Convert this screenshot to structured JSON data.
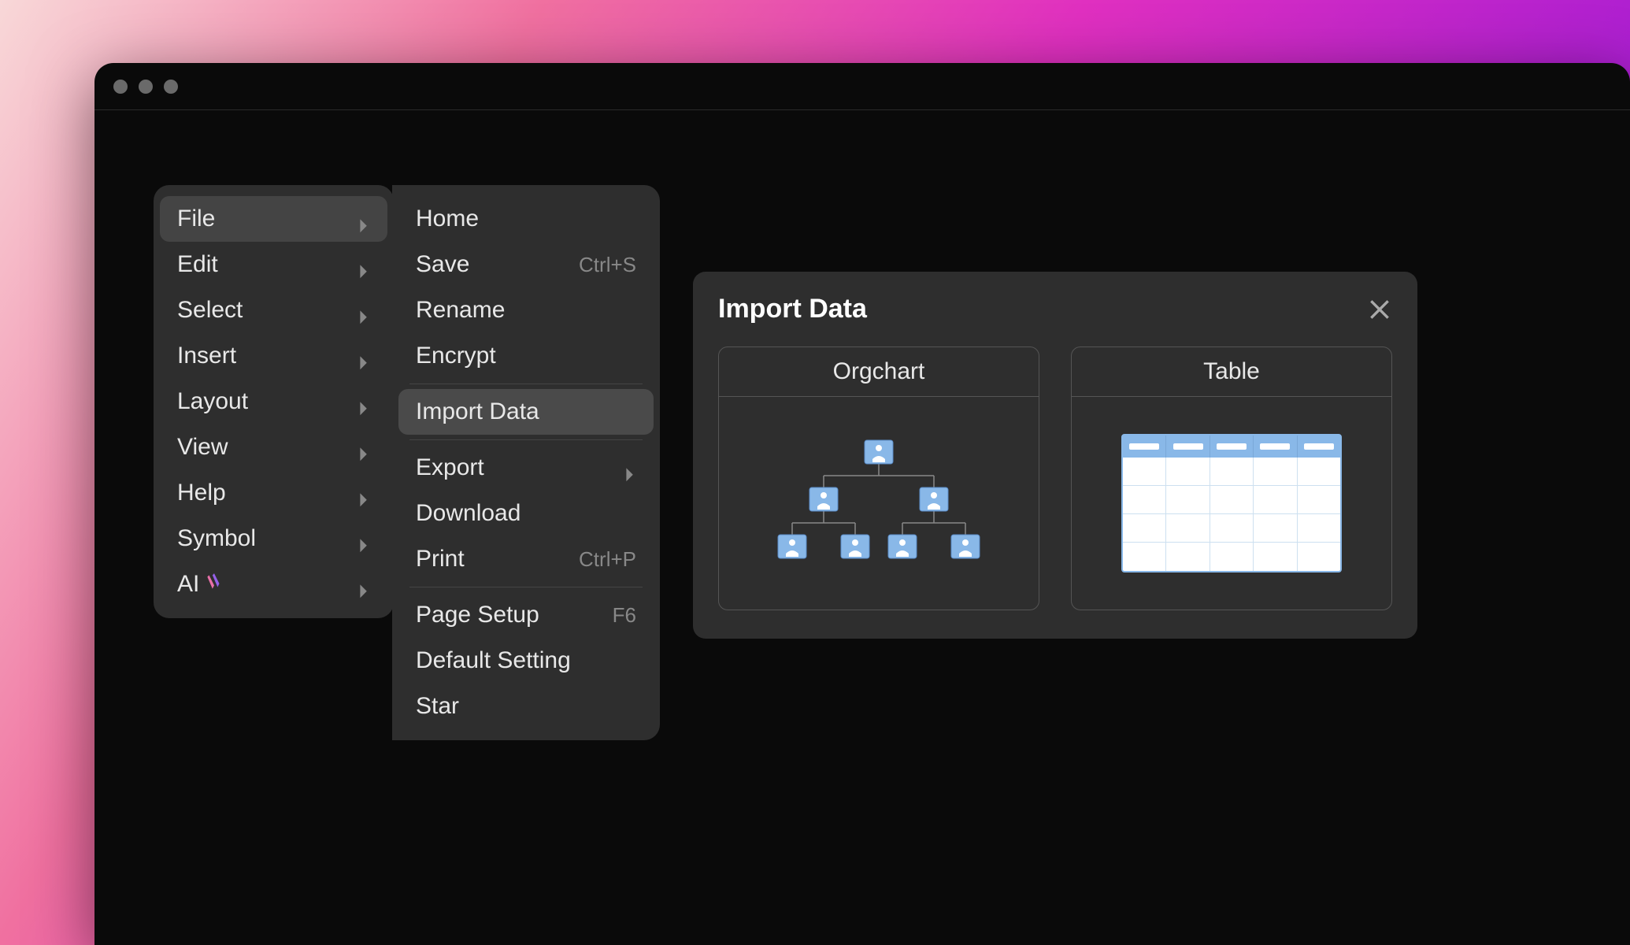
{
  "main_menu": {
    "items": [
      {
        "label": "File",
        "has_submenu": true,
        "active": true
      },
      {
        "label": "Edit",
        "has_submenu": true
      },
      {
        "label": "Select",
        "has_submenu": true
      },
      {
        "label": "Insert",
        "has_submenu": true
      },
      {
        "label": "Layout",
        "has_submenu": true
      },
      {
        "label": "View",
        "has_submenu": true
      },
      {
        "label": "Help",
        "has_submenu": true
      },
      {
        "label": "Symbol",
        "has_submenu": true
      },
      {
        "label": "AI",
        "has_submenu": true,
        "badge": true
      }
    ]
  },
  "file_submenu": {
    "items": [
      {
        "label": "Home"
      },
      {
        "label": "Save",
        "shortcut": "Ctrl+S"
      },
      {
        "label": "Rename"
      },
      {
        "label": "Encrypt"
      },
      {
        "divider": true
      },
      {
        "label": "Import Data",
        "highlighted": true
      },
      {
        "divider": true
      },
      {
        "label": "Export",
        "has_submenu": true
      },
      {
        "label": "Download"
      },
      {
        "label": "Print",
        "shortcut": "Ctrl+P"
      },
      {
        "divider": true
      },
      {
        "label": "Page Setup",
        "shortcut": "F6"
      },
      {
        "label": "Default Setting"
      },
      {
        "label": "Star"
      }
    ]
  },
  "dialog": {
    "title": "Import Data",
    "options": [
      {
        "label": "Orgchart",
        "type": "orgchart"
      },
      {
        "label": "Table",
        "type": "table"
      }
    ]
  }
}
